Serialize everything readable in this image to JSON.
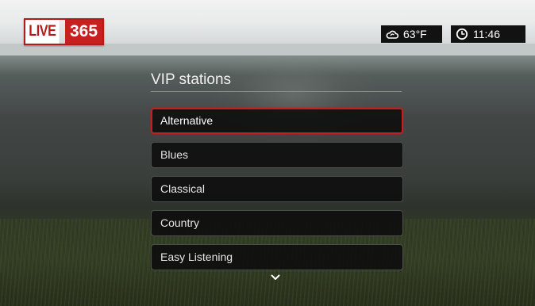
{
  "app": {
    "logo_left": "LIVE",
    "logo_right": "365"
  },
  "status_bar": {
    "weather": {
      "icon": "cloud-icon",
      "temperature": "63°F"
    },
    "clock": {
      "icon": "clock-icon",
      "time": "11:46"
    }
  },
  "main": {
    "title": "VIP stations",
    "items": [
      {
        "label": "Alternative",
        "selected": true
      },
      {
        "label": "Blues",
        "selected": false
      },
      {
        "label": "Classical",
        "selected": false
      },
      {
        "label": "Country",
        "selected": false
      },
      {
        "label": "Easy Listening",
        "selected": false
      }
    ],
    "scroll_indicator": "chevron-down-icon"
  },
  "colors": {
    "accent": "#c41e1e",
    "logo_red": "#c8201f",
    "list_bg": "#0c0c0c"
  }
}
